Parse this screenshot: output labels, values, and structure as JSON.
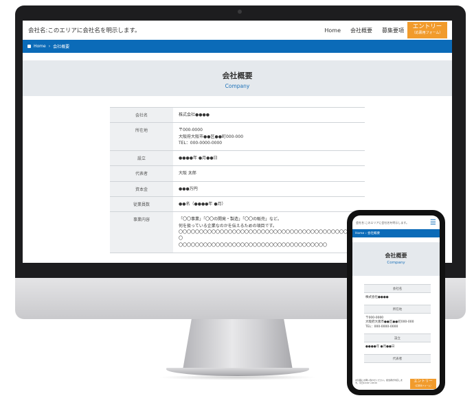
{
  "site": {
    "title": "会社名:このエリアに会社名を明示します。",
    "nav": [
      "Home",
      "会社概要",
      "募集要項"
    ],
    "entry_label": "エントリー",
    "entry_sub": "（応募用フォーム）"
  },
  "breadcrumb": {
    "home": "Home",
    "separator": "›",
    "current": "会社概要"
  },
  "page": {
    "title_jp": "会社概要",
    "title_en": "Company"
  },
  "table": [
    {
      "label": "会社名",
      "value": "株式会社●●●●"
    },
    {
      "label": "所在地",
      "value": "〒000-0000\n大阪府大阪市●●区●●町000-000\nTEL：000-0000-0000"
    },
    {
      "label": "設立",
      "value": "●●●●年 ●月●●日"
    },
    {
      "label": "代表者",
      "value": "大阪 太郎"
    },
    {
      "label": "資本金",
      "value": "●●●万円"
    },
    {
      "label": "従業員数",
      "value": "●●名（●●●●年 ●月）"
    },
    {
      "label": "事業内容",
      "value": "「〇〇事業」「〇〇の開発・製造」「〇〇の販売」など。\n何を扱っている企業なのかを伝えるための項目です。\n〇〇〇〇〇〇〇〇〇〇〇〇〇〇〇〇〇〇〇〇〇〇〇〇〇〇〇〇〇〇〇〇〇〇〇〇〇〇〇〇〇〇〇〇\n〇〇〇〇〇〇〇〇〇〇〇〇〇〇〇〇〇〇〇〇〇〇〇〇〇〇〇〇〇〇〇〇〇〇〇〇"
    }
  ],
  "mobile": {
    "header_text": "会社名:このエリアに会社名を明示します。",
    "menu_icon": "hamburger-icon",
    "footer_text": "お気軽にお問い合わせください。担当者が対応します。平日10:00〜18:00",
    "entry_label": "エントリー",
    "entry_sub": "（応募用フォーム）",
    "rows": [
      {
        "label": "会社名",
        "value": "株式会社●●●●"
      },
      {
        "label": "所在地",
        "value": "〒000-0000\n大阪府大阪市●●区●●町000-000\nTEL：000-0000-0000"
      },
      {
        "label": "設立",
        "value": "●●●●年 ●月●●日"
      },
      {
        "label": "代表者",
        "value": ""
      }
    ]
  },
  "colors": {
    "brand_blue": "#0b6bb8",
    "entry_orange": "#f19b2c",
    "band_gray": "#e5e9ed"
  }
}
